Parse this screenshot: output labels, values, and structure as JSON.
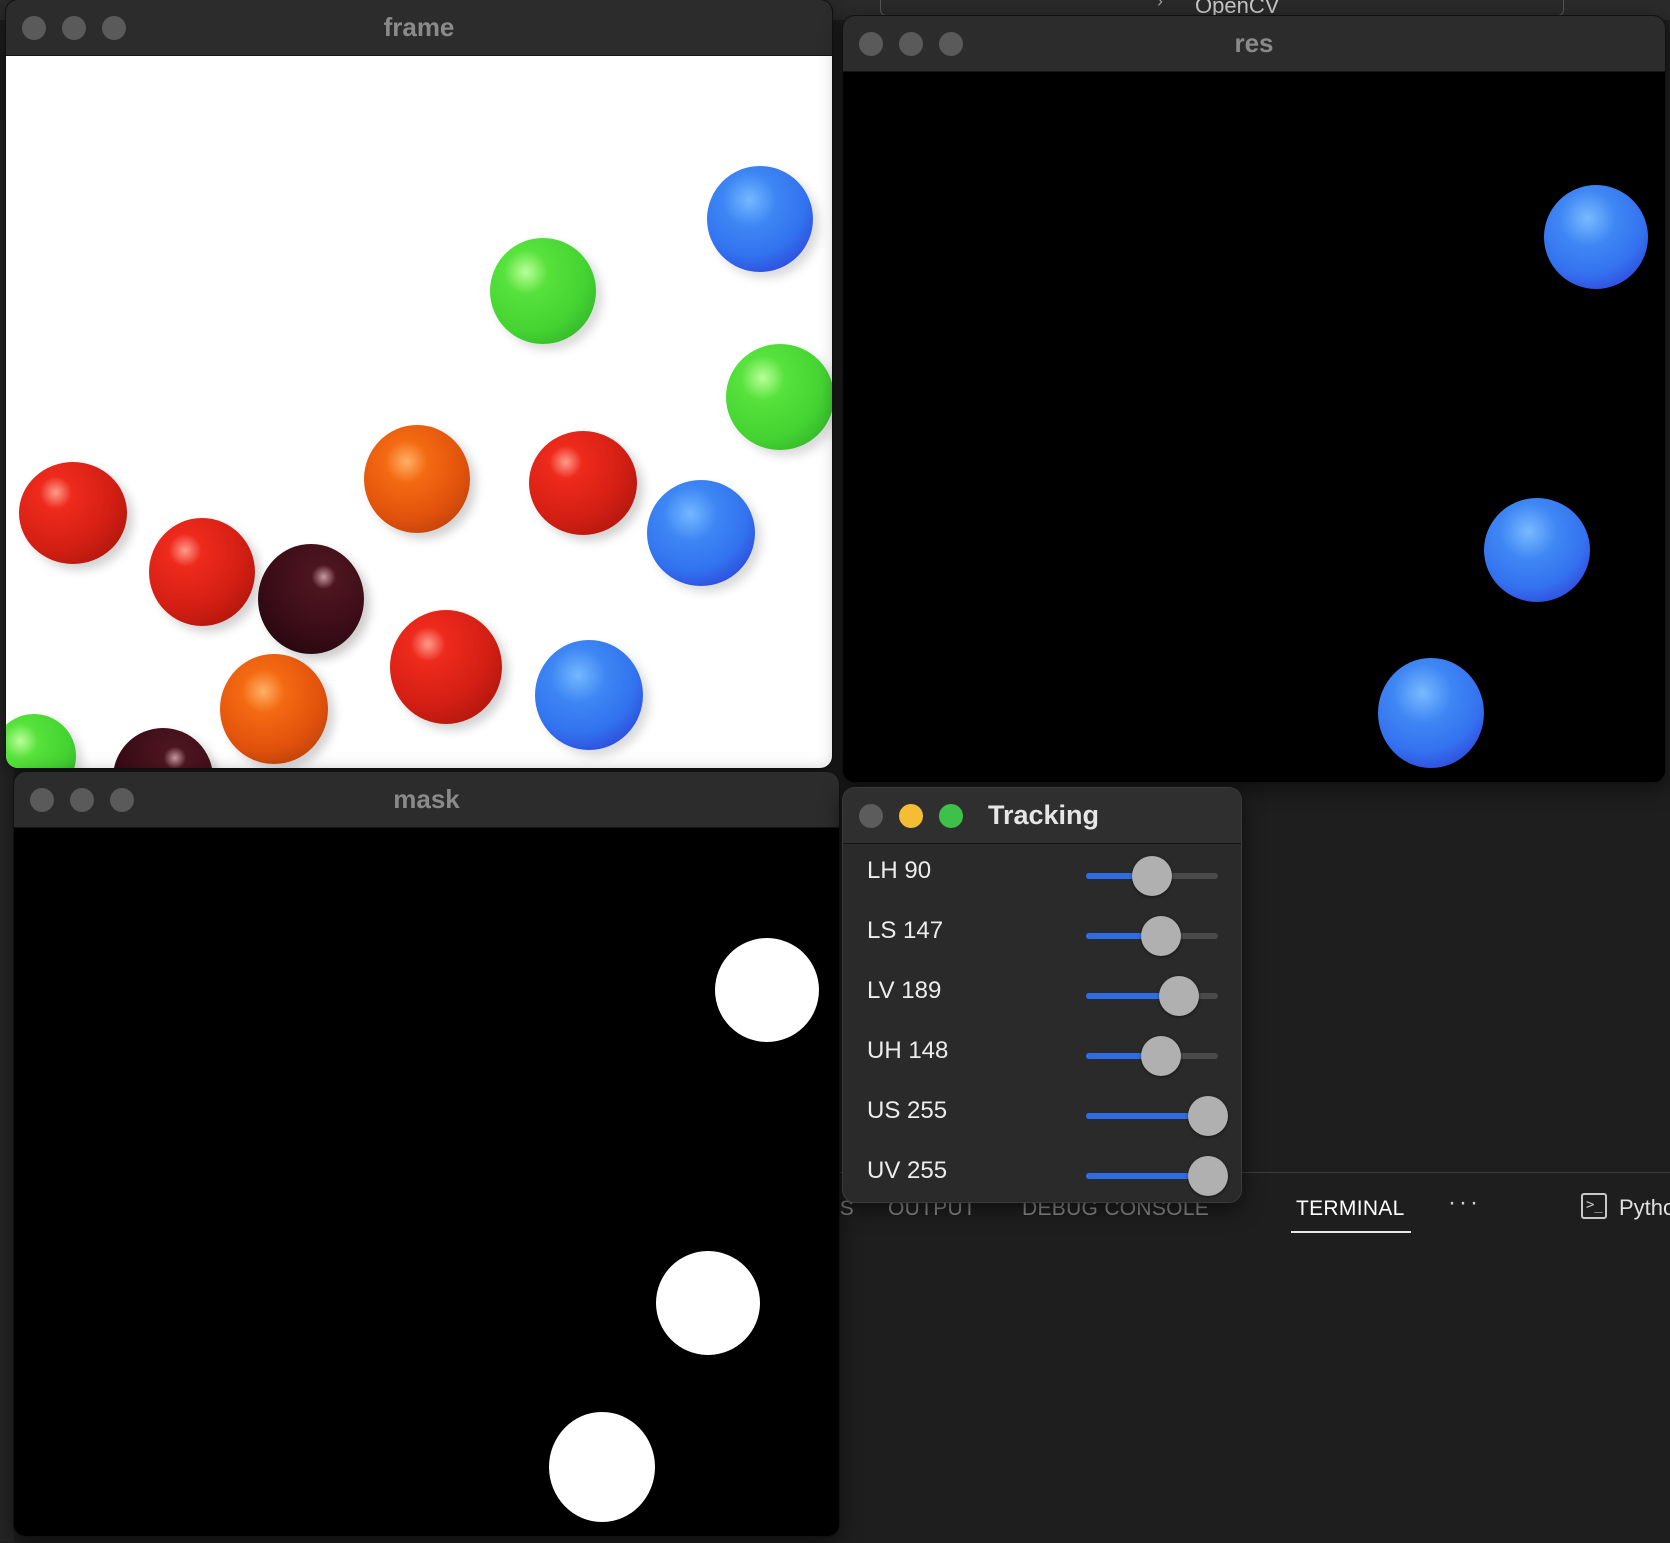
{
  "background": {
    "search_text": "OpenCV",
    "panel_tabs": [
      {
        "label": "PROBLEMS",
        "visible_text": "MS"
      },
      {
        "label": "OUTPUT"
      },
      {
        "label": "DEBUG CONSOLE"
      },
      {
        "label": "TERMINAL",
        "active": true
      }
    ],
    "more_label": "···",
    "terminal_name": "Python"
  },
  "windows": {
    "frame": {
      "title": "frame"
    },
    "res": {
      "title": "res"
    },
    "mask": {
      "title": "mask"
    },
    "tracking": {
      "title": "Tracking"
    }
  },
  "sliders": [
    {
      "label": "LH 90",
      "name": "LH",
      "value": 90,
      "max": 179
    },
    {
      "label": "LS 147",
      "name": "LS",
      "value": 147,
      "max": 255
    },
    {
      "label": "LV 189",
      "name": "LV",
      "value": 189,
      "max": 255
    },
    {
      "label": "UH 148",
      "name": "UH",
      "value": 148,
      "max": 255
    },
    {
      "label": "US 255",
      "name": "US",
      "value": 255,
      "max": 255
    },
    {
      "label": "UV 255",
      "name": "UV",
      "value": 255,
      "max": 255
    }
  ],
  "colors": {
    "slider_fill": "#2f6de6",
    "traffic_yellow": "#f5bd33",
    "traffic_green": "#3ec14a"
  }
}
